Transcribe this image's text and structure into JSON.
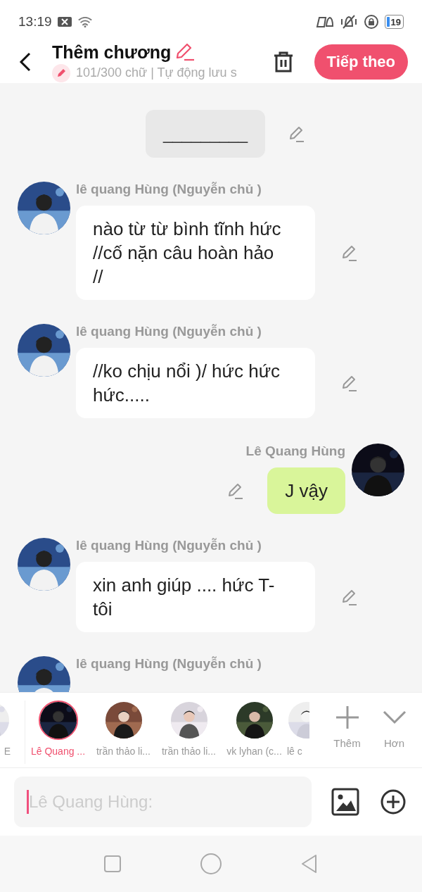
{
  "status_bar": {
    "time": "13:19",
    "battery": "19"
  },
  "header": {
    "title": "Thêm chương",
    "subtitle": "101/300 chữ | Tự động lưu s",
    "next_button": "Tiếp theo"
  },
  "messages": [
    {
      "kind": "narration",
      "text": "_________"
    },
    {
      "kind": "incoming",
      "sender": "lê quang Hùng (Nguyễn chủ )",
      "text": "nào từ từ bình tĩnh hức //cố nặn câu hoàn hảo //"
    },
    {
      "kind": "incoming",
      "sender": "lê quang Hùng (Nguyễn chủ )",
      "text": "//ko chịu nổi )/ hức hức hức....."
    },
    {
      "kind": "outgoing",
      "sender": "Lê Quang Hùng",
      "text": "J vậy"
    },
    {
      "kind": "incoming",
      "sender": "lê quang Hùng (Nguyễn chủ )",
      "text": "xin anh giúp .... hức T-tôi"
    },
    {
      "kind": "incoming",
      "sender": "lê quang Hùng (Nguyễn chủ )"
    }
  ],
  "characters": [
    {
      "kind": "cut_left",
      "name": "E",
      "selected": false
    },
    {
      "kind": "full",
      "name": "Lê Quang ...",
      "selected": true
    },
    {
      "kind": "full",
      "name": "trần thảo li...",
      "selected": false
    },
    {
      "kind": "full",
      "name": "trần thảo li...",
      "selected": false
    },
    {
      "kind": "full",
      "name": "vk lyhan (c...",
      "selected": false
    },
    {
      "kind": "cut_right",
      "name": "lê c",
      "selected": false
    }
  ],
  "actions": [
    {
      "kind": "add",
      "label": "Thêm"
    },
    {
      "kind": "more",
      "label": "Hơn"
    }
  ],
  "composer": {
    "placeholder": "Lê Quang Hùng:"
  }
}
